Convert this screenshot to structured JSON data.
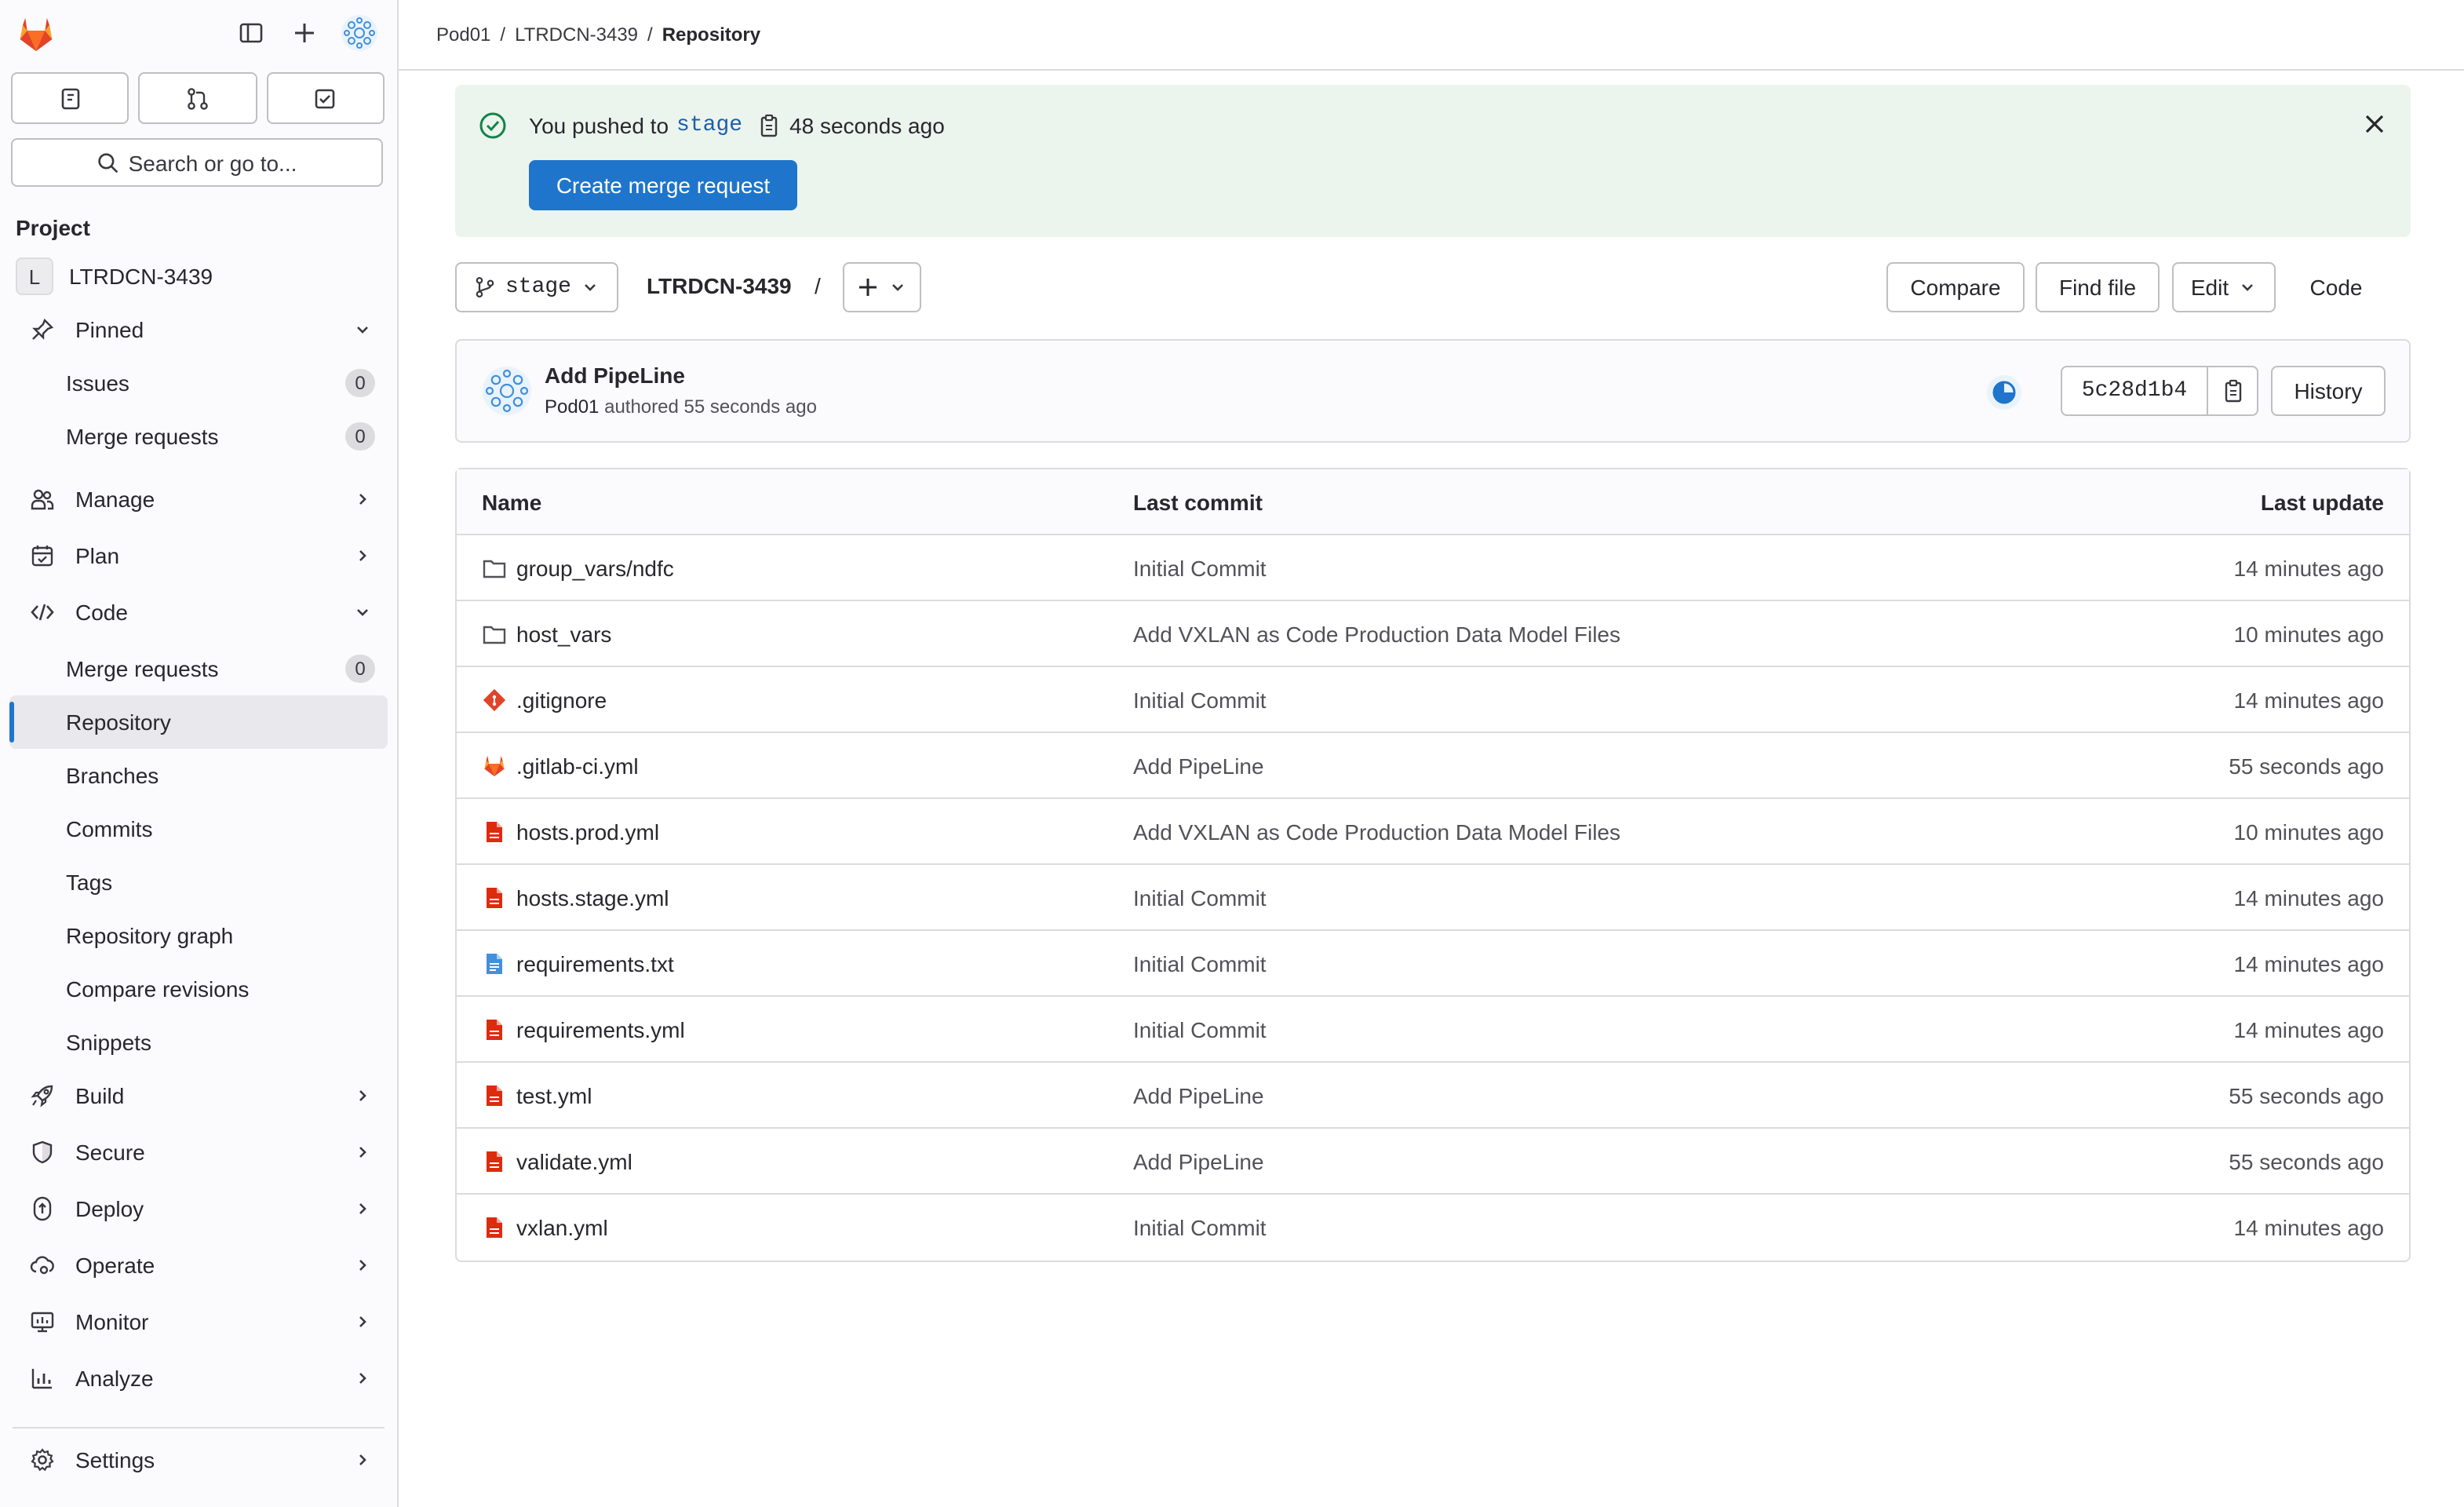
{
  "sidebar": {
    "search_label": "Search or go to...",
    "section_title": "Project",
    "project_letter": "L",
    "project_name": "LTRDCN-3439",
    "pinned": "Pinned",
    "pinned_items": [
      {
        "label": "Issues",
        "count": "0"
      },
      {
        "label": "Merge requests",
        "count": "0"
      }
    ],
    "manage": "Manage",
    "plan": "Plan",
    "code": "Code",
    "code_items": [
      {
        "label": "Merge requests",
        "count": "0"
      },
      {
        "label": "Repository"
      },
      {
        "label": "Branches"
      },
      {
        "label": "Commits"
      },
      {
        "label": "Tags"
      },
      {
        "label": "Repository graph"
      },
      {
        "label": "Compare revisions"
      },
      {
        "label": "Snippets"
      }
    ],
    "build": "Build",
    "secure": "Secure",
    "deploy": "Deploy",
    "operate": "Operate",
    "monitor": "Monitor",
    "analyze": "Analyze",
    "settings": "Settings"
  },
  "breadcrumb": {
    "items": [
      "Pod01",
      "LTRDCN-3439",
      "Repository"
    ],
    "separator": "/"
  },
  "alert": {
    "prefix": "You pushed to",
    "branch": "stage",
    "time": "48 seconds ago",
    "button": "Create merge request"
  },
  "toolbar": {
    "branch": "stage",
    "repo": "LTRDCN-3439",
    "slash": "/",
    "compare": "Compare",
    "find_file": "Find file",
    "edit": "Edit",
    "code": "Code"
  },
  "commit": {
    "title": "Add PipeLine",
    "author": "Pod01",
    "meta": "authored 55 seconds ago",
    "sha": "5c28d1b4",
    "history": "History"
  },
  "table": {
    "headers": {
      "name": "Name",
      "last_commit": "Last commit",
      "last_update": "Last update"
    },
    "rows": [
      {
        "name": "group_vars/ndfc",
        "icon": "folder-icon",
        "commit": "Initial Commit",
        "update": "14 minutes ago"
      },
      {
        "name": "host_vars",
        "icon": "folder-icon",
        "commit": "Add VXLAN as Code Production Data Model Files",
        "update": "10 minutes ago"
      },
      {
        "name": ".gitignore",
        "icon": "git-icon",
        "commit": "Initial Commit",
        "update": "14 minutes ago"
      },
      {
        "name": ".gitlab-ci.yml",
        "icon": "gitlab-icon",
        "commit": "Add PipeLine",
        "update": "55 seconds ago"
      },
      {
        "name": "hosts.prod.yml",
        "icon": "yaml-file-icon",
        "commit": "Add VXLAN as Code Production Data Model Files",
        "update": "10 minutes ago"
      },
      {
        "name": "hosts.stage.yml",
        "icon": "yaml-file-icon",
        "commit": "Initial Commit",
        "update": "14 minutes ago"
      },
      {
        "name": "requirements.txt",
        "icon": "text-file-icon",
        "commit": "Initial Commit",
        "update": "14 minutes ago"
      },
      {
        "name": "requirements.yml",
        "icon": "yaml-file-icon",
        "commit": "Initial Commit",
        "update": "14 minutes ago"
      },
      {
        "name": "test.yml",
        "icon": "yaml-file-icon",
        "commit": "Add PipeLine",
        "update": "55 seconds ago"
      },
      {
        "name": "validate.yml",
        "icon": "yaml-file-icon",
        "commit": "Add PipeLine",
        "update": "55 seconds ago"
      },
      {
        "name": "vxlan.yml",
        "icon": "yaml-file-icon",
        "commit": "Initial Commit",
        "update": "14 minutes ago"
      }
    ]
  },
  "colors": {
    "accent": "#1f75cb",
    "alert_bg": "#ecf4ee",
    "success": "#108548",
    "yaml_red": "#dd2b0e",
    "text_blue": "#428fdc"
  }
}
